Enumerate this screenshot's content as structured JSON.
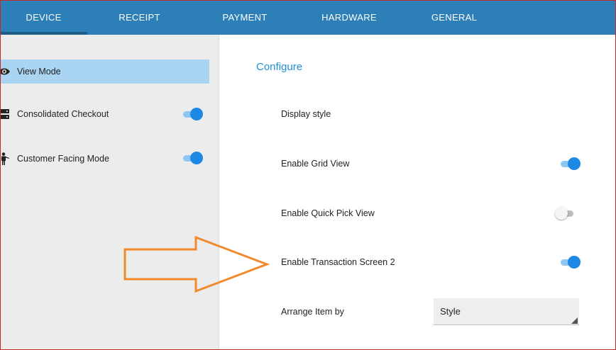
{
  "tabs": [
    {
      "label": "DEVICE",
      "active": true
    },
    {
      "label": "RECEIPT",
      "active": false
    },
    {
      "label": "PAYMENT",
      "active": false
    },
    {
      "label": "HARDWARE",
      "active": false
    },
    {
      "label": "GENERAL",
      "active": false
    }
  ],
  "sidebar": {
    "items": [
      {
        "label": "View Mode",
        "icon": "eye-icon",
        "selected": true
      },
      {
        "label": "Consolidated Checkout",
        "icon": "server-icon",
        "toggle_on": true
      },
      {
        "label": "Customer Facing Mode",
        "icon": "person-icon",
        "toggle_on": true
      }
    ]
  },
  "main": {
    "section_title": "Configure",
    "settings": [
      {
        "label": "Display style"
      },
      {
        "label": "Enable Grid View",
        "toggle_on": true
      },
      {
        "label": "Enable Quick Pick View",
        "toggle_on": false
      },
      {
        "label": "Enable Transaction Screen 2",
        "toggle_on": true
      },
      {
        "label": "Arrange Item by",
        "select_value": "Style"
      }
    ]
  },
  "colors": {
    "tab_bar": "#2d7fb8",
    "accent": "#1e88e5",
    "selected_row": "#a9d4f2",
    "annotation_arrow": "#f08a2c"
  }
}
